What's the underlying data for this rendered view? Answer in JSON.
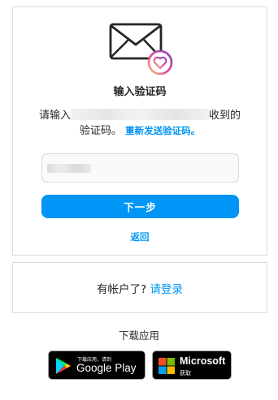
{
  "verify": {
    "title": "输入验证码",
    "desc_prefix": "请输入",
    "desc_suffix": "收到的",
    "desc_line2": "验证码。",
    "resend_link": "重新发送验证码。",
    "code_input_placeholder": "",
    "next_button": "下一步",
    "back_link": "返回"
  },
  "login_prompt": {
    "text": "有帐户了?",
    "link": "请登录"
  },
  "download": {
    "title": "下载应用",
    "google_play": {
      "small": "下载应用，请到",
      "big": "Google Play"
    },
    "microsoft": {
      "big": "Microsoft",
      "small": "获取"
    }
  },
  "colors": {
    "accent": "#0095f6",
    "border": "#dbdbdb",
    "text": "#262626"
  }
}
